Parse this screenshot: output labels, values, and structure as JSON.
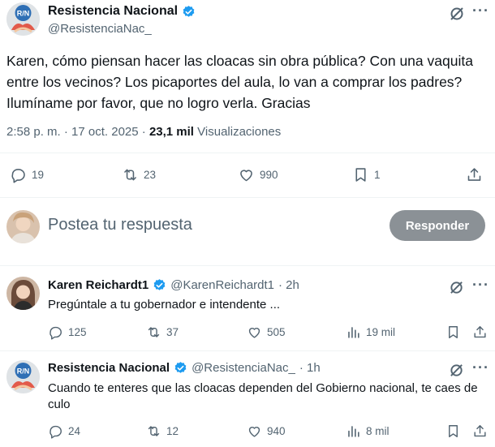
{
  "main_tweet": {
    "author_name": "Resistencia Nacional",
    "author_handle": "@ResistenciaNac_",
    "avatar_text": "R/N",
    "text": "Karen, cómo piensan hacer las cloacas sin obra pública? Con una vaquita entre los vecinos? Los picaportes del aula, lo van a comprar los padres? Ilumíname por favor, que no logro verla. Gracias",
    "time": "2:58 p. m. · 17 oct. 2025 · ",
    "views_count": "23,1 mil",
    "views_label": "Visualizaciones",
    "stats": {
      "replies": "19",
      "reposts": "23",
      "likes": "990",
      "bookmarks": "1"
    }
  },
  "compose": {
    "placeholder": "Postea tu respuesta",
    "button_label": "Responder"
  },
  "replies": [
    {
      "author_name": "Karen Reichardt1",
      "author_handle": "@KarenReichardt1",
      "time": "· 2h",
      "text": "Pregúntale a tu gobernador e intendente ...",
      "stats": {
        "replies": "125",
        "reposts": "37",
        "likes": "505",
        "views": "19 mil"
      }
    },
    {
      "author_name": "Resistencia Nacional",
      "author_handle": "@ResistenciaNac_",
      "avatar_text": "R/N",
      "time": "· 1h",
      "text": "Cuando te enteres que las cloacas dependen del Gobierno nacional, te caes de culo",
      "stats": {
        "replies": "24",
        "reposts": "12",
        "likes": "940",
        "views": "8 mil"
      }
    }
  ],
  "colors": {
    "verified": "#1d9bf0",
    "text": "#0f1419",
    "secondary": "#536471",
    "button_disabled": "#8b9196"
  }
}
